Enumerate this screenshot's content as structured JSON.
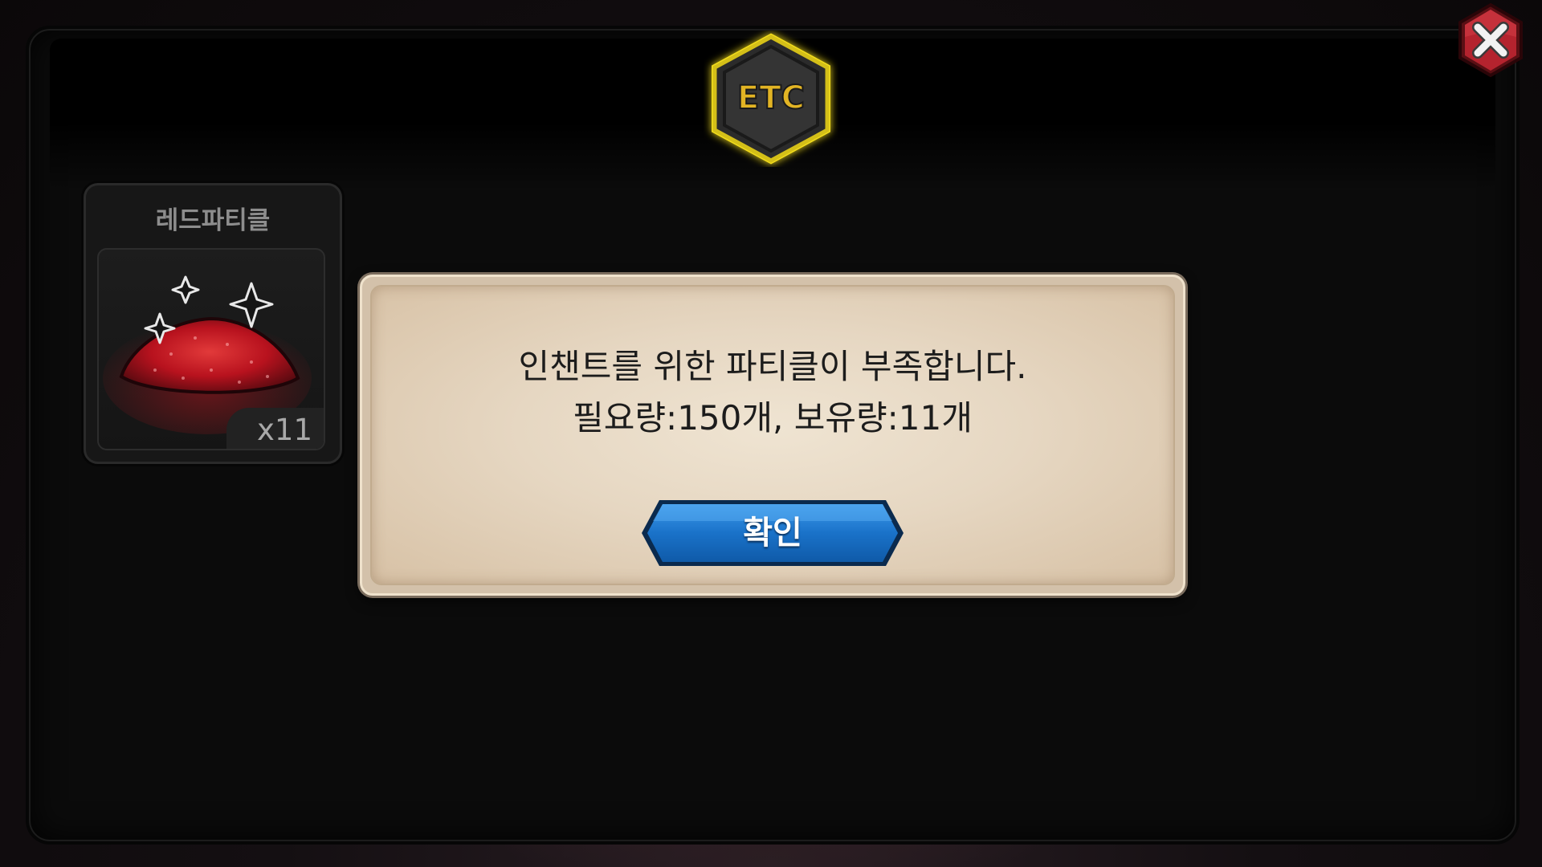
{
  "badge": {
    "label": "ETC"
  },
  "close_button": {
    "icon": "close-icon"
  },
  "item": {
    "name": "레드파티클",
    "count": "x11",
    "icon": "red-particle-icon"
  },
  "dialog": {
    "message_line1": "인챈트를 위한 파티클이 부족합니다.",
    "message_line2": "필요량:150개, 보유량:11개",
    "confirm_label": "확인"
  },
  "colors": {
    "badge_glow": "#f2dc1c",
    "badge_text": "#e2b424",
    "close_red": "#b4232e",
    "particle_red": "#b8121e",
    "confirm_blue": "#1a72c9",
    "dialog_bg": "#e6d7c2"
  }
}
